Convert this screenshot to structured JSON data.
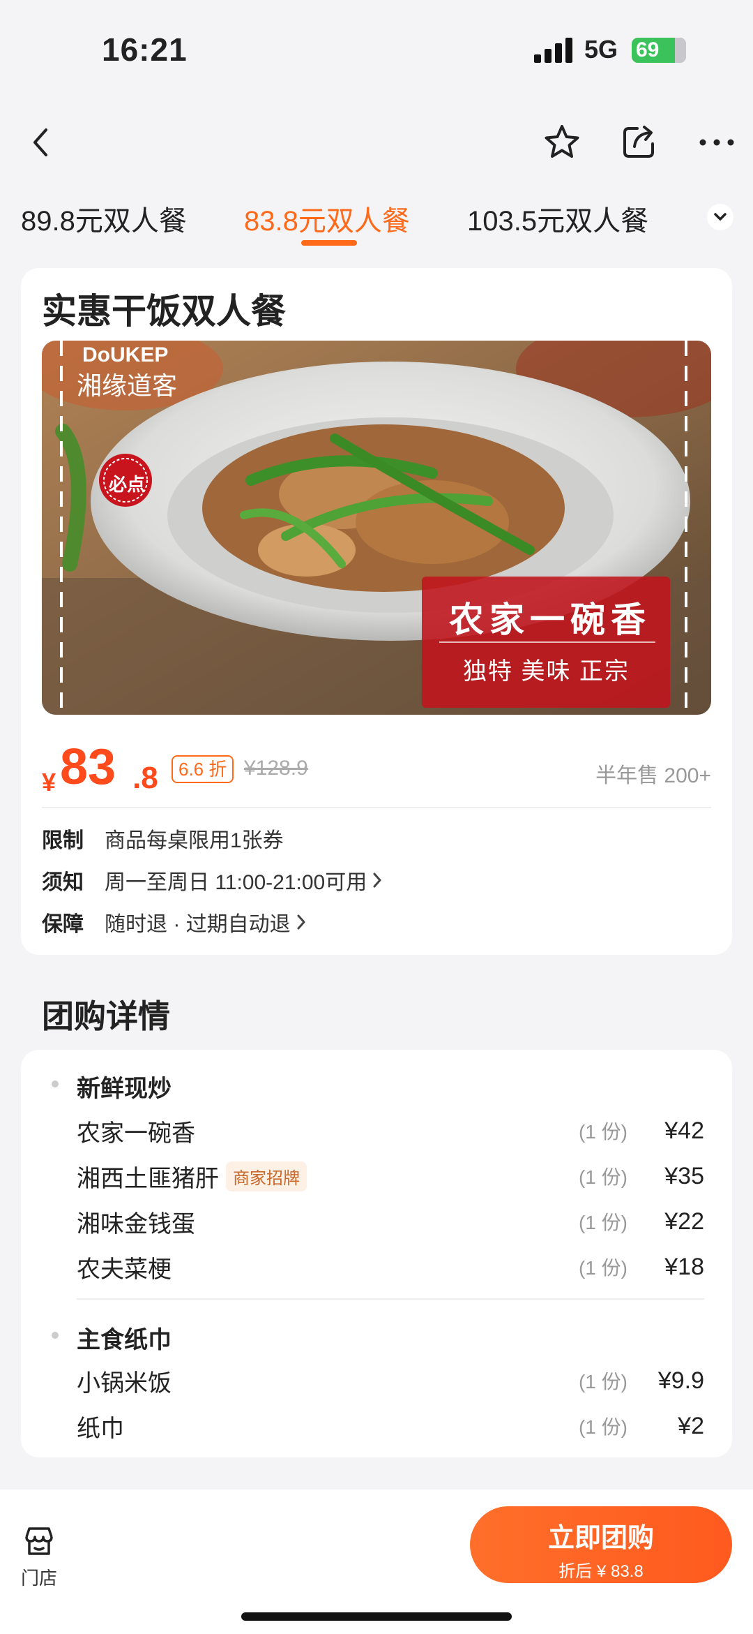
{
  "status_bar": {
    "time": "16:21",
    "network": "5G",
    "battery": "69"
  },
  "nav": {
    "back_icon": "chevron-left-icon",
    "favorite_icon": "star-icon",
    "share_icon": "share-icon",
    "more_icon": "more-icon"
  },
  "tabs": [
    {
      "label": "89.8元双人餐"
    },
    {
      "label": "83.8元双人餐",
      "active": true
    },
    {
      "label": "103.5元双人餐"
    }
  ],
  "deal": {
    "title": "实惠干饭双人餐",
    "photo": {
      "brand": "湘缘道客",
      "brand_en": "DoUKEP",
      "badge": "必点",
      "dish_name": "农家一碗香",
      "slogan": "独特 美味 正宗"
    },
    "currency": "¥",
    "price_int": "83",
    "price_dec": ".8",
    "discount": "6.6 折",
    "original_price": "¥128.9",
    "sold": "半年售 200+",
    "rules": [
      {
        "key": "限制",
        "value": "商品每桌限用1张券"
      },
      {
        "key": "须知",
        "value": "周一至周日 11:00-21:00可用"
      },
      {
        "key": "保障",
        "value": "随时退 · 过期自动退"
      }
    ]
  },
  "details": {
    "heading": "团购详情",
    "groups": [
      {
        "name": "新鲜现炒",
        "items": [
          {
            "name": "农家一碗香",
            "qty": "(1 份)",
            "price": "¥42"
          },
          {
            "name": "湘西土匪猪肝",
            "tag": "商家招牌",
            "qty": "(1 份)",
            "price": "¥35"
          },
          {
            "name": "湘味金钱蛋",
            "qty": "(1 份)",
            "price": "¥22"
          },
          {
            "name": "农夫菜梗",
            "qty": "(1 份)",
            "price": "¥18"
          }
        ]
      },
      {
        "name": "主食纸巾",
        "items": [
          {
            "name": "小锅米饭",
            "qty": "(1 份)",
            "price": "¥9.9"
          },
          {
            "name": "纸巾",
            "qty": "(1 份)",
            "price": "¥2"
          }
        ]
      }
    ]
  },
  "bottom_bar": {
    "store_label": "门店",
    "buy_label": "立即团购",
    "buy_sub": "折后 ¥ 83.8"
  },
  "colors": {
    "accent": "#ff6a1a",
    "price": "#ff4a1c",
    "battery": "#3cc25a"
  }
}
